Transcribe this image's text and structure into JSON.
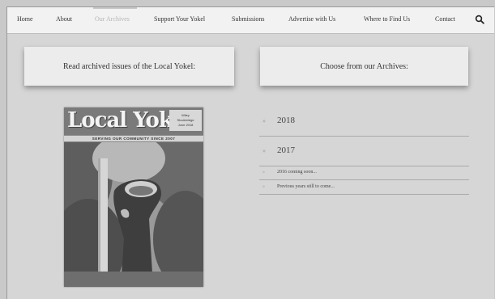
{
  "nav": {
    "items": [
      {
        "label": "Home"
      },
      {
        "label": "About"
      },
      {
        "label": "Our Archives"
      },
      {
        "label": "Support Your Yokel"
      },
      {
        "label": "Submissions"
      },
      {
        "label": "Advertise with Us"
      },
      {
        "label": "Where to Find Us"
      },
      {
        "label": "Contact"
      }
    ],
    "active": "Our Archives",
    "search_icon": "search-icon"
  },
  "left_panel": {
    "title": "Read archived issues of the Local Yokel:"
  },
  "right_panel": {
    "title": "Choose from our Archives:"
  },
  "cover": {
    "title": "Local Yokel",
    "badge_lines": [
      "Wiley",
      "Stockbridge",
      "June 2018"
    ],
    "tagline": "SERVING OUR COMMUNITY SINCE 2007"
  },
  "archives": {
    "bullet": "»",
    "years": [
      {
        "label": "2018"
      },
      {
        "label": "2017"
      }
    ],
    "notes": [
      {
        "label": "2016 coming soon..."
      },
      {
        "label": "Previous years still to come..."
      }
    ]
  }
}
